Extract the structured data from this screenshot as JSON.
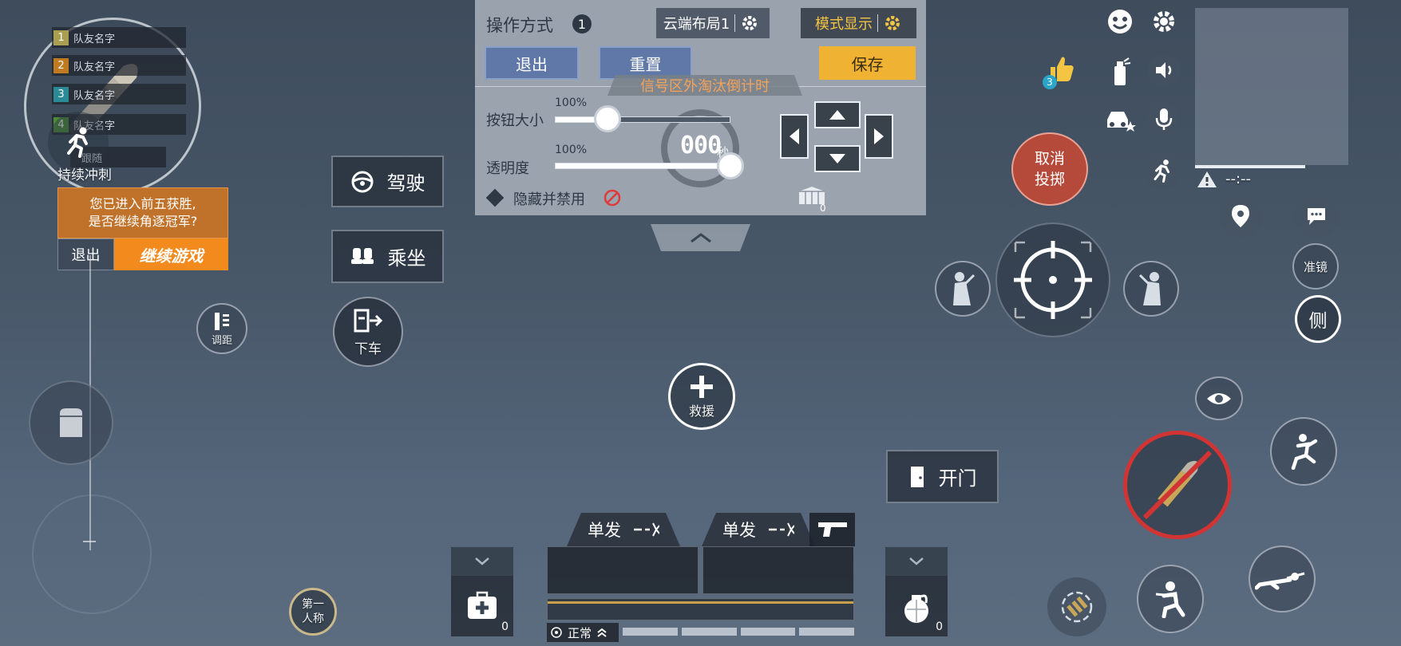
{
  "minimap": {
    "teammates": [
      {
        "num": "1",
        "label": "队友名字",
        "color": "#a8a050"
      },
      {
        "num": "2",
        "label": "队友名字",
        "color": "#c07a20"
      },
      {
        "num": "3",
        "label": "队友名字",
        "color": "#2a8a96"
      },
      {
        "num": "4",
        "label": "队友名字",
        "color": "#4d8a3a"
      }
    ],
    "follow_label": "跟随",
    "sprint_label": "持续冲刺"
  },
  "prompt": {
    "message": "您已进入前五获胜,\n是否继续角逐冠军?",
    "exit_label": "退出",
    "continue_label": "继续游戏"
  },
  "left_controls": {
    "drive_label": "驾驶",
    "ride_label": "乘坐",
    "exit_vehicle_label": "下车",
    "adjust_label": "调距",
    "first_person_label": "第一人称"
  },
  "panel": {
    "title": "操作方式",
    "layout_num": "1",
    "cloud_layout_label": "云端布局1",
    "mode_display_label": "模式显示",
    "exit_label": "退出",
    "reset_label": "重置",
    "save_label": "保存",
    "countdown_label": "信号区外淘汰倒计时",
    "countdown_value": "000",
    "countdown_unit": "秒",
    "button_size_label": "按钮大小",
    "button_size_value": "100%",
    "button_size_level": 0.3,
    "opacity_label": "透明度",
    "opacity_value": "100%",
    "opacity_level": 1.0,
    "hide_disable_label": "隐藏并禁用",
    "crate_count": "0"
  },
  "center": {
    "rescue_label": "救援",
    "open_door_label": "开门"
  },
  "right_controls": {
    "like_count": "3",
    "cancel_throw_label": "取消投掷",
    "time_label": "--:--",
    "scope_label": "准镜",
    "side_label": "侧"
  },
  "weapons": {
    "fire_mode_1": "单发",
    "fire_mode_2": "单发",
    "status_label": "正常",
    "medkit_count": "0",
    "grenade_count": "0"
  }
}
